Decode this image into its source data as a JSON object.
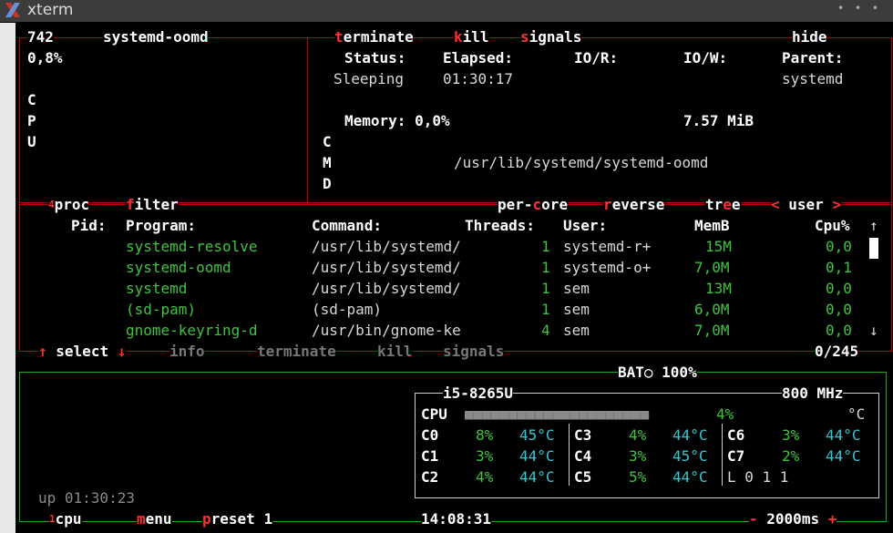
{
  "window": {
    "title": "xterm"
  },
  "proc_detail": {
    "pid": "742",
    "name": "systemd-oomd",
    "cpu_percent": "0,8%",
    "cpu_vertical": [
      "C",
      "P",
      "U"
    ],
    "actions": {
      "t": "t",
      "terminate": "erminate",
      "k": "k",
      "kill": "ill",
      "s": "s",
      "signals": "ignals",
      "hide": "hide"
    },
    "headers": {
      "status": "Status:",
      "elapsed": "Elapsed:",
      "ior": "IO/R:",
      "iow": "IO/W:",
      "parent": "Parent:"
    },
    "values": {
      "status": "Sleeping",
      "elapsed": "01:30:17",
      "parent": "systemd"
    },
    "memory_label": "Memory: 0,0%",
    "memory_value": "7.57 MiB",
    "cmd_vertical": [
      "C",
      "M",
      "D"
    ],
    "cmd": "/usr/lib/systemd/systemd-oomd"
  },
  "proc_box": {
    "sup": "4",
    "proc": "proc",
    "f": "f",
    "filter": "ilter",
    "percore": {
      "a": "per-",
      "c": "c",
      "b": "ore"
    },
    "reverse": {
      "r": "r",
      "rest": "everse"
    },
    "tree": {
      "a": "tr",
      "e": "e",
      "b": "e"
    },
    "sort": {
      "lt": "<",
      "label": "user",
      "gt": ">"
    },
    "columns": {
      "pid": "Pid:",
      "program": "Program:",
      "command": "Command:",
      "threads": "Threads:",
      "user": "User:",
      "mem": "MemB",
      "cpu": "Cpu%"
    },
    "up_arrow": "↑",
    "down_arrow": "↓",
    "rows": [
      {
        "program": "systemd-resolve",
        "command": "/usr/lib/systemd/",
        "threads": "1",
        "user": "systemd-r+",
        "mem": "15M",
        "cpu": "0,0"
      },
      {
        "program": "systemd-oomd",
        "command": "/usr/lib/systemd/",
        "threads": "1",
        "user": "systemd-o+",
        "mem": "7,0M",
        "cpu": "0,1"
      },
      {
        "program": "systemd",
        "command": "/usr/lib/systemd/",
        "threads": "1",
        "user": "sem",
        "mem": "13M",
        "cpu": "0,0"
      },
      {
        "program": "(sd-pam)",
        "command": "(sd-pam)",
        "threads": "1",
        "user": "sem",
        "mem": "6,0M",
        "cpu": "0,0"
      },
      {
        "program": "gnome-keyring-d",
        "command": "/usr/bin/gnome-ke",
        "threads": "4",
        "user": "sem",
        "mem": "7,0M",
        "cpu": "0,0"
      }
    ],
    "footer": {
      "up": "↑",
      "select": "select",
      "down": "↓",
      "info": "info",
      "terminate": "terminate",
      "kill": "kill",
      "signals": "signals",
      "count": "0/245"
    }
  },
  "cpu_box": {
    "battery": "BAT○ 100%",
    "model": "i5-8265U",
    "freq": "800 MHz",
    "cpu_label": "CPU",
    "cpu_bar": "■■■■■■■■■■■■■■■■■■■■■",
    "cpu_total": "4%",
    "unit": "°C",
    "cores": [
      {
        "name": "C0",
        "usage": "8%",
        "temp": "45°C"
      },
      {
        "name": "C1",
        "usage": "3%",
        "temp": "44°C"
      },
      {
        "name": "C2",
        "usage": "4%",
        "temp": "44°C"
      },
      {
        "name": "C3",
        "usage": "4%",
        "temp": "44°C"
      },
      {
        "name": "C4",
        "usage": "3%",
        "temp": "45°C"
      },
      {
        "name": "C5",
        "usage": "5%",
        "temp": "44°C"
      },
      {
        "name": "C6",
        "usage": "3%",
        "temp": "44°C"
      },
      {
        "name": "C7",
        "usage": "2%",
        "temp": "44°C"
      }
    ],
    "load": "L 0 1 1",
    "uptime": "up 01:30:23",
    "footer": {
      "sup": "1",
      "cpu": "cpu",
      "m": "m",
      "menu": "enu",
      "p": "p",
      "preset": "reset 1",
      "clock": "14:08:31",
      "minus": "-",
      "interval": "2000ms",
      "plus": "+"
    }
  },
  "colors": {
    "box": "#c00000",
    "cpu_box": "#1fa81f",
    "program": "#3ec43e",
    "temp": "#35c8d2",
    "hotkey": "#ff3030"
  }
}
